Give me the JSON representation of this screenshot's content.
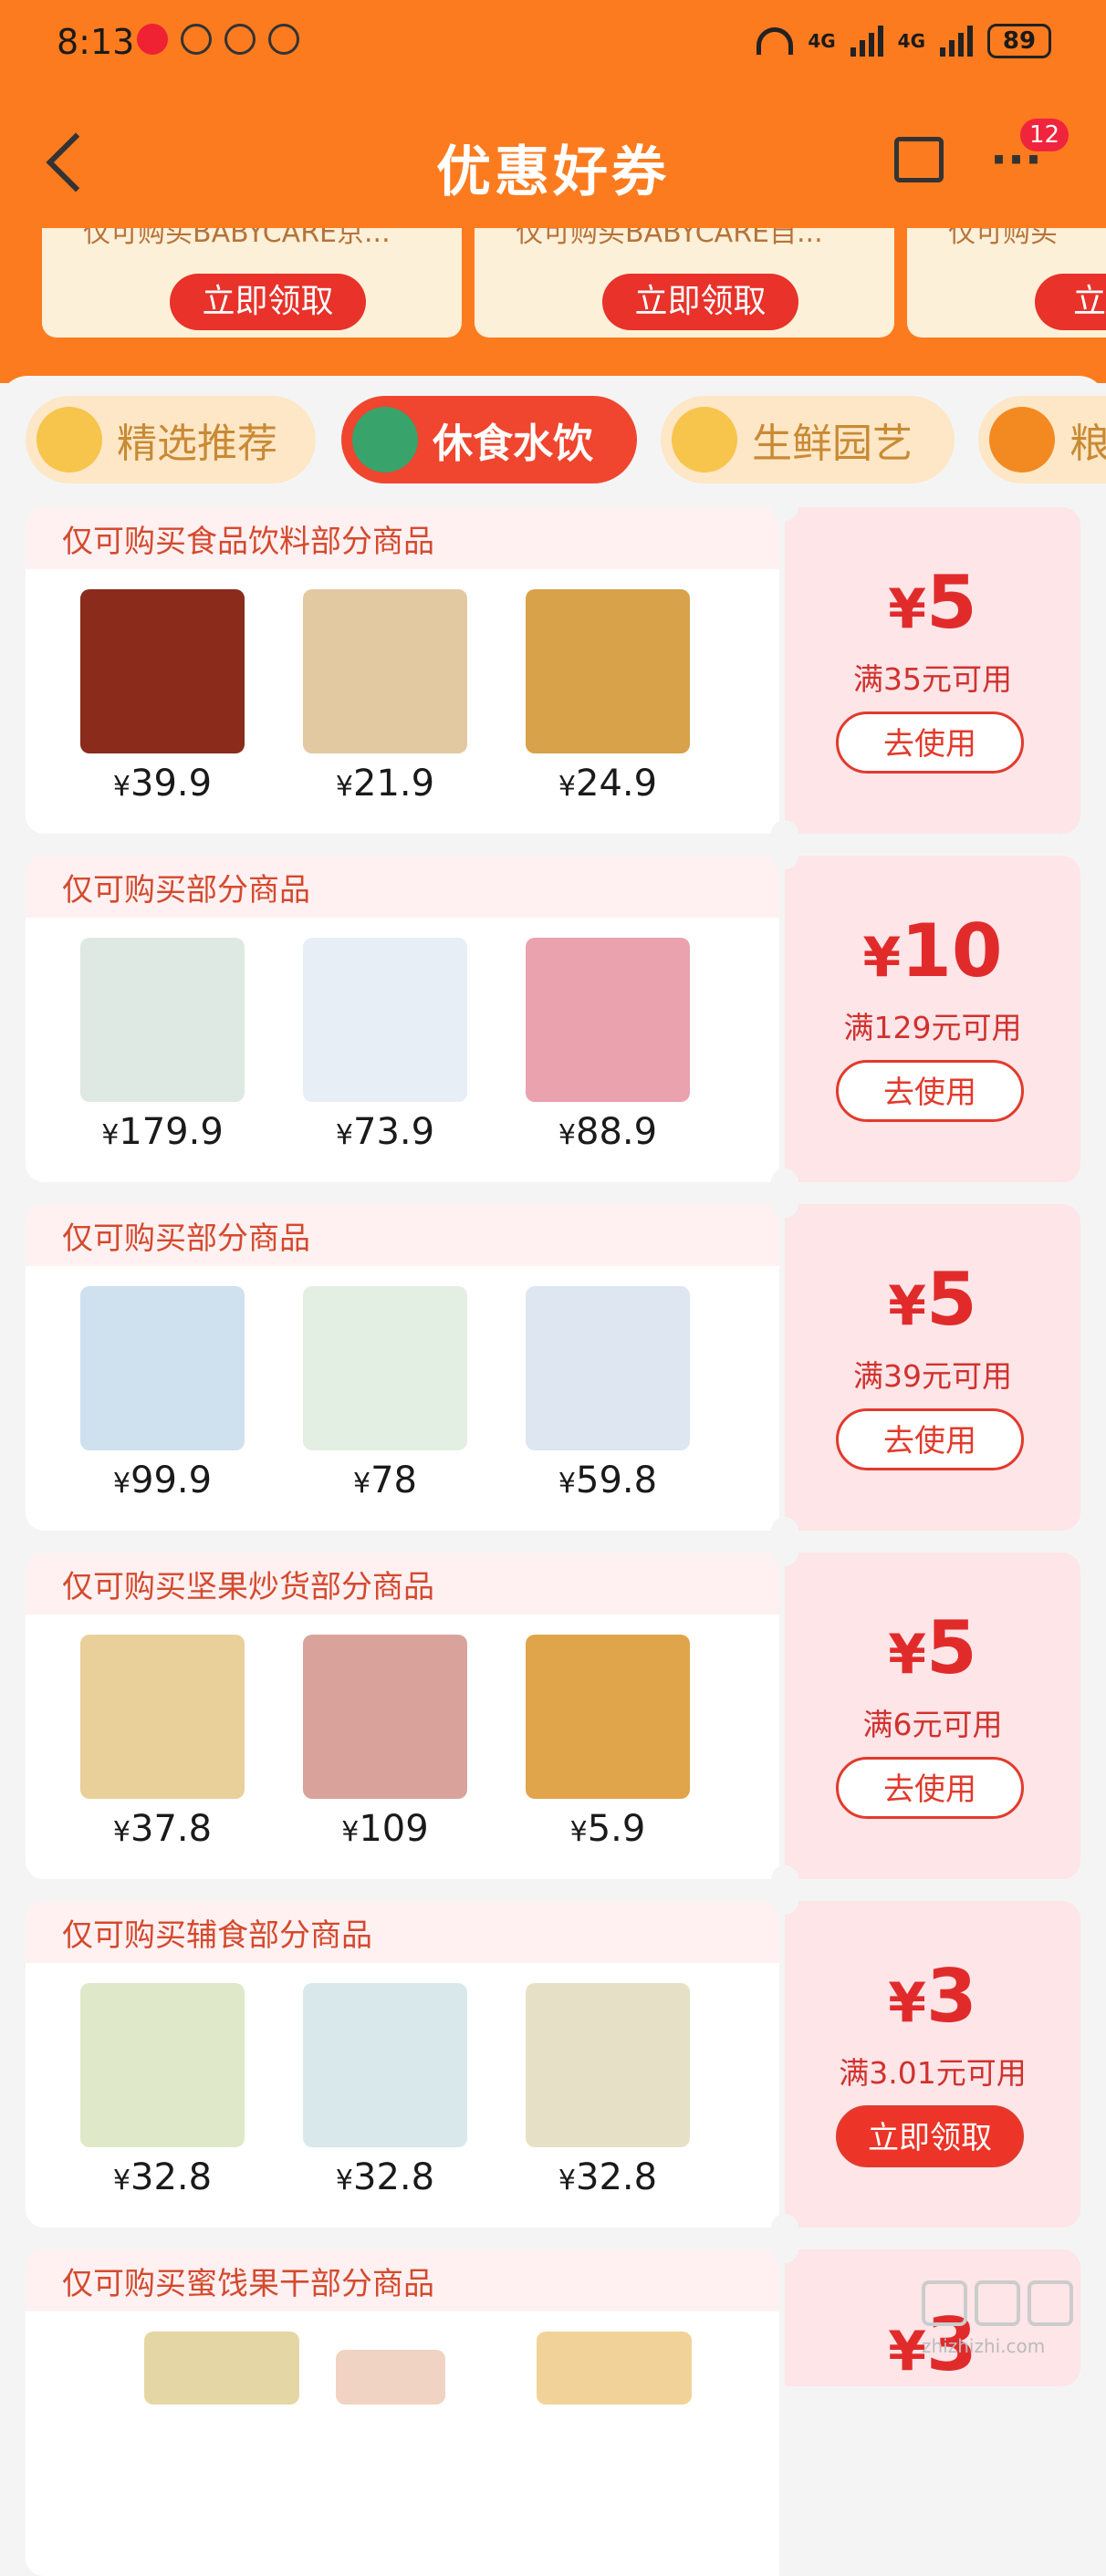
{
  "status_bar": {
    "time": "8:13",
    "battery": "89",
    "net1": "4G",
    "net2": "4G"
  },
  "nav": {
    "title": "优惠好券",
    "badge": "12"
  },
  "top_coupons": [
    {
      "desc": "仅可购买BABYCARE京...",
      "claim": "立即领取"
    },
    {
      "desc": "仅可购买BABYCARE自...",
      "claim": "立即领取"
    },
    {
      "desc": "仅可购买",
      "claim": "立"
    }
  ],
  "tabs": [
    {
      "label": "精选推荐"
    },
    {
      "label": "休食水饮"
    },
    {
      "label": "生鲜园艺"
    },
    {
      "label": "粮"
    }
  ],
  "coupons": [
    {
      "head": "仅可购买食品饮料部分商品",
      "amount": "5",
      "condition": "满35元可用",
      "action": "去使用",
      "prices": [
        "39.9",
        "21.9",
        "24.9"
      ]
    },
    {
      "head": "仅可购买部分商品",
      "amount": "10",
      "condition": "满129元可用",
      "action": "去使用",
      "prices": [
        "179.9",
        "73.9",
        "88.9"
      ]
    },
    {
      "head": "仅可购买部分商品",
      "amount": "5",
      "condition": "满39元可用",
      "action": "去使用",
      "prices": [
        "99.9",
        "78",
        "59.8"
      ]
    },
    {
      "head": "仅可购买坚果炒货部分商品",
      "amount": "5",
      "condition": "满6元可用",
      "action": "去使用",
      "prices": [
        "37.8",
        "109",
        "5.9"
      ]
    },
    {
      "head": "仅可购买辅食部分商品",
      "amount": "3",
      "condition": "满3.01元可用",
      "action": "立即领取",
      "prices": [
        "32.8",
        "32.8",
        "32.8"
      ]
    },
    {
      "head": "仅可购买蜜饯果干部分商品",
      "amount": "3",
      "condition": "",
      "action": "",
      "prices": []
    }
  ],
  "currency": "¥",
  "watermark": "zhizhizhi.com",
  "colors": {
    "header_bg": "#fd7b1f",
    "accent_red": "#e12b2b",
    "coupon_bg": "#fde5e8"
  }
}
